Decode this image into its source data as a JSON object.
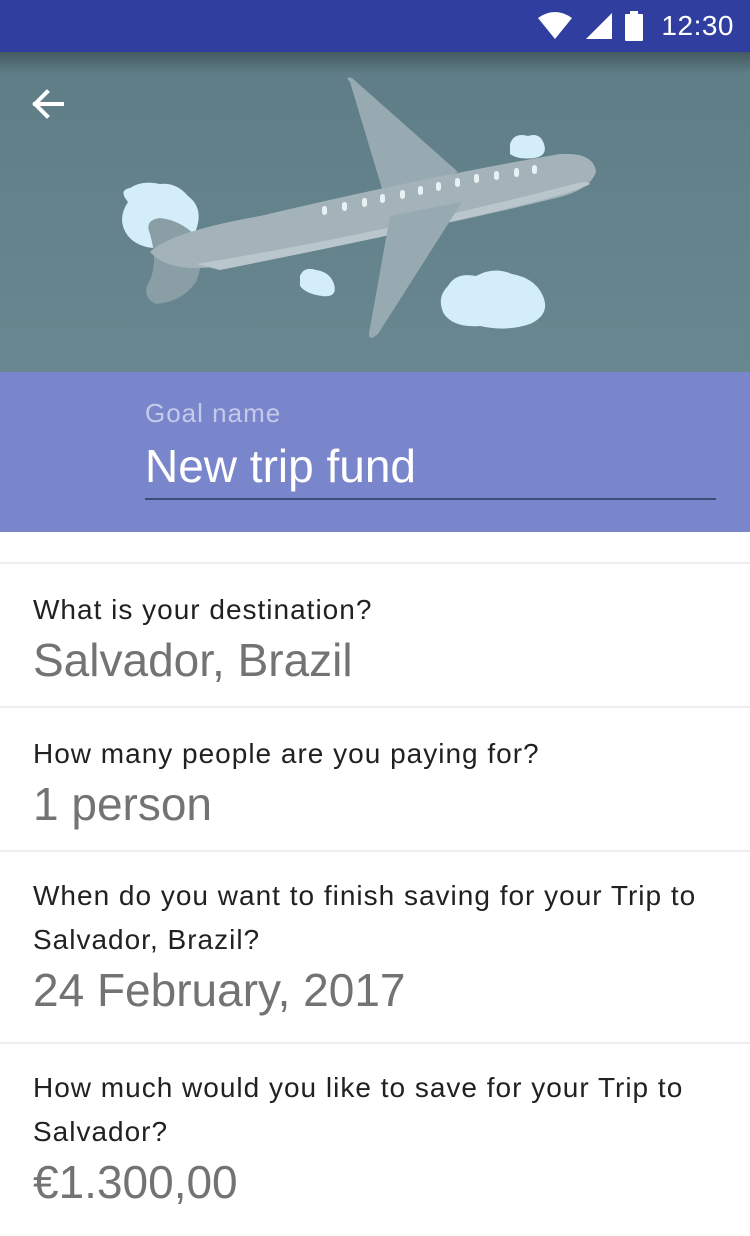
{
  "status_bar": {
    "time": "12:30",
    "icons": [
      "wifi-icon",
      "cell-signal-icon",
      "battery-icon"
    ],
    "color": "#303f9f"
  },
  "header": {
    "back_icon": "arrow-back-icon",
    "illustration": "airplane-illustration",
    "background_color": "#688790"
  },
  "goal": {
    "label": "Goal name",
    "value": "New trip fund",
    "background_color": "#7986cb"
  },
  "form": {
    "items": [
      {
        "question": "What is your destination?",
        "answer": "Salvador, Brazil"
      },
      {
        "question": "How many people are you paying for?",
        "answer": "1 person"
      },
      {
        "question": "When do you want to finish saving for your Trip to Salvador, Brazil?",
        "answer": "24 February, 2017"
      },
      {
        "question": "How much would you like to save for your Trip to Salvador?",
        "answer": "€1.300,00"
      }
    ]
  }
}
